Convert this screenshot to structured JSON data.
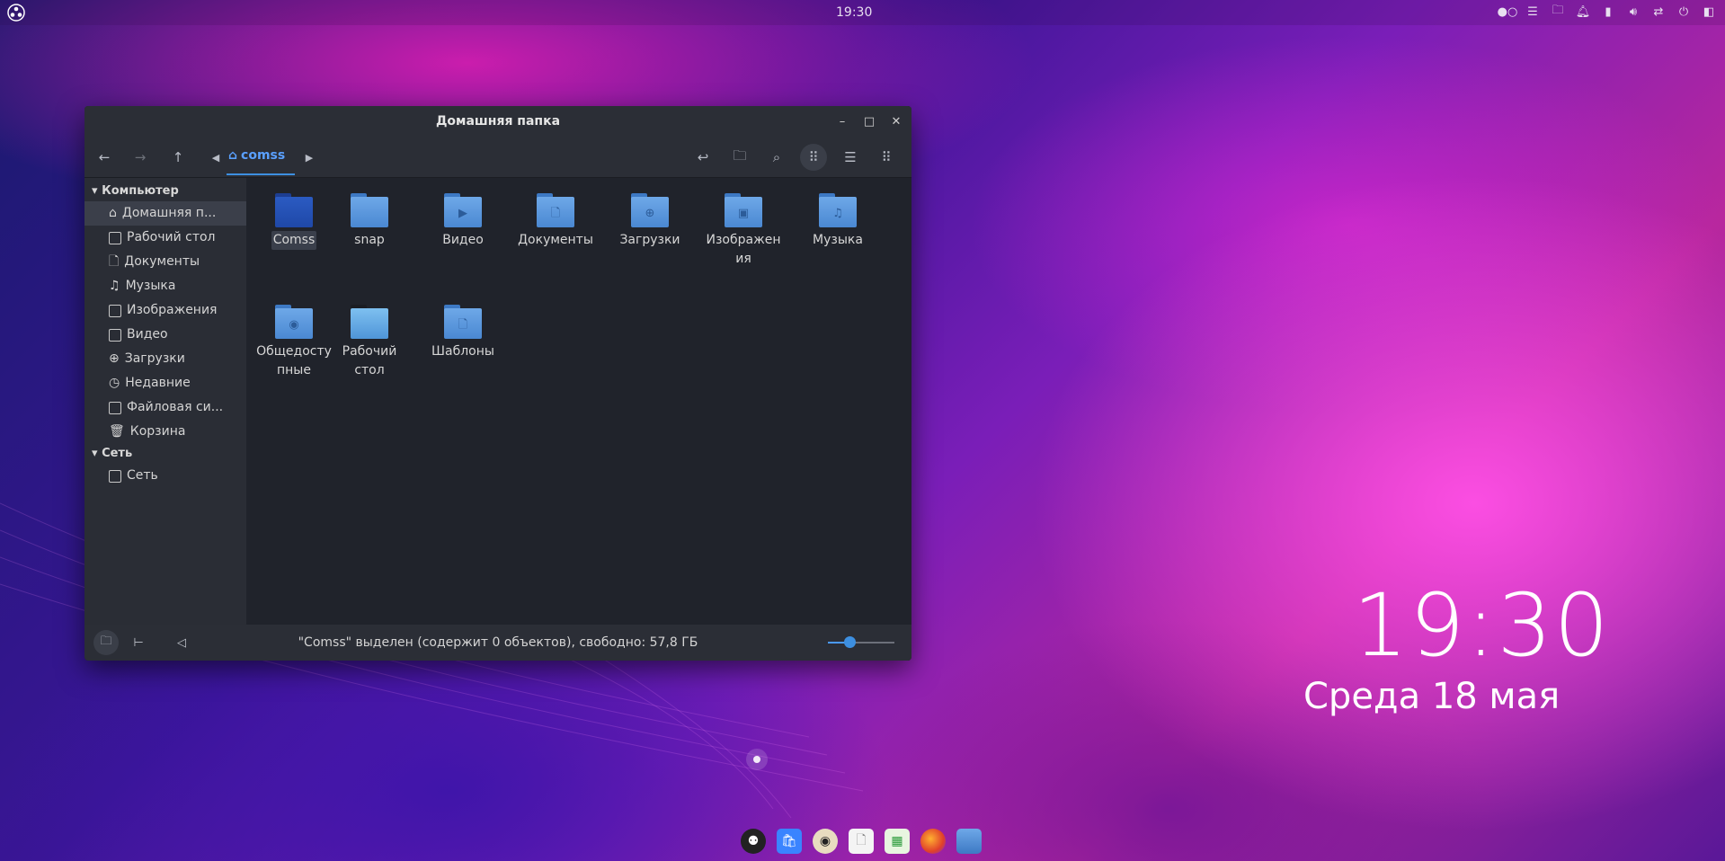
{
  "topbar": {
    "clock": "19:30",
    "tray_icons": [
      "toggle-icon",
      "list-icon",
      "folder-icon",
      "bell-icon",
      "battery-icon",
      "volume-icon",
      "network-icon",
      "power-icon",
      "sidebar-icon"
    ]
  },
  "desktop": {
    "time": "19:30",
    "date": "Среда 18 мая"
  },
  "window": {
    "title": "Домашняя папка",
    "breadcrumb": "comss",
    "sidebar": {
      "groups": [
        {
          "label": "Компьютер",
          "items": [
            {
              "label": "Домашняя п...",
              "icon": "home-icon"
            },
            {
              "label": "Рабочий стол",
              "icon": "desktop-icon"
            },
            {
              "label": "Документы",
              "icon": "document-icon"
            },
            {
              "label": "Музыка",
              "icon": "music-icon"
            },
            {
              "label": "Изображения",
              "icon": "image-icon"
            },
            {
              "label": "Видео",
              "icon": "video-icon"
            },
            {
              "label": "Загрузки",
              "icon": "download-icon"
            },
            {
              "label": "Недавние",
              "icon": "clock-icon"
            },
            {
              "label": "Файловая си...",
              "icon": "drive-icon"
            },
            {
              "label": "Корзина",
              "icon": "trash-icon"
            }
          ]
        },
        {
          "label": "Сеть",
          "items": [
            {
              "label": "Сеть",
              "icon": "network-icon"
            }
          ]
        }
      ]
    },
    "files": [
      {
        "name": "Comss",
        "selected": true
      },
      {
        "name": "snap"
      },
      {
        "name": "Видео"
      },
      {
        "name": "Документы"
      },
      {
        "name": "Загрузки"
      },
      {
        "name": "Изображения"
      },
      {
        "name": "Музыка"
      },
      {
        "name": "Общедоступные"
      },
      {
        "name": "Рабочий стол"
      },
      {
        "name": "Шаблоны"
      }
    ],
    "status": "\"Comss\" выделен (содержит 0 объектов), свободно: 57,8 ГБ",
    "zoom_level": 0.32
  }
}
